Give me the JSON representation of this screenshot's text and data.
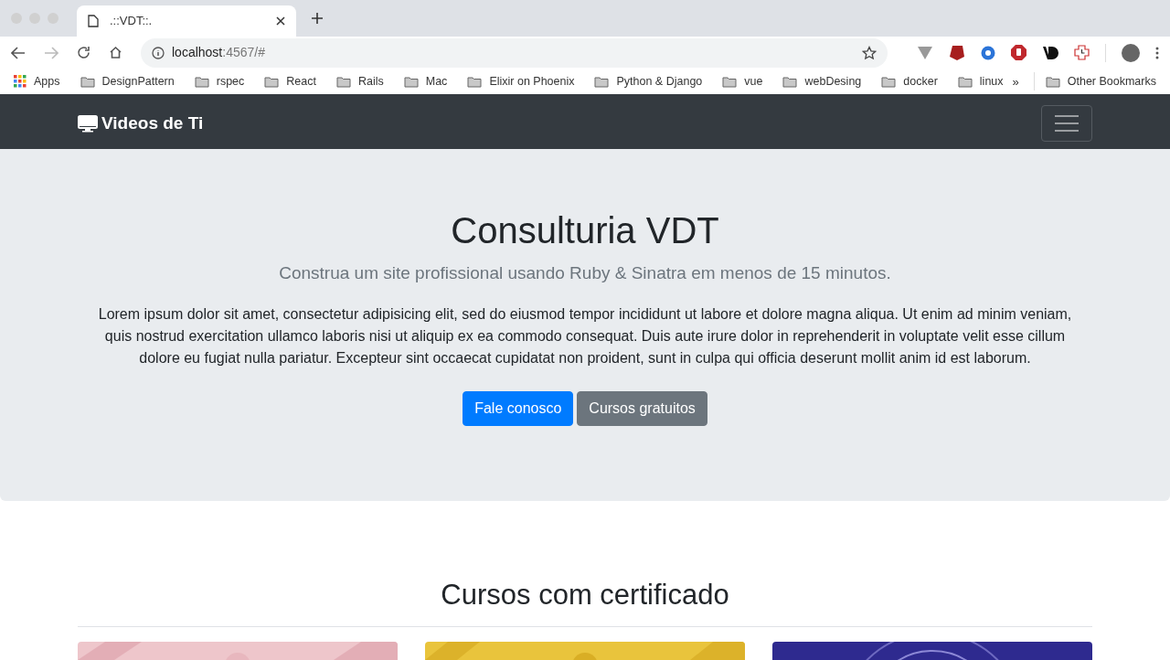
{
  "browser": {
    "tab_title": ".::VDT::.",
    "url_host": "localhost",
    "url_rest": ":4567/#",
    "bookmarks": [
      {
        "label": "Apps",
        "kind": "apps"
      },
      {
        "label": "DesignPattern",
        "kind": "folder"
      },
      {
        "label": "rspec",
        "kind": "folder"
      },
      {
        "label": "React",
        "kind": "folder"
      },
      {
        "label": "Rails",
        "kind": "folder"
      },
      {
        "label": "Mac",
        "kind": "folder"
      },
      {
        "label": "Elixir on Phoenix",
        "kind": "folder"
      },
      {
        "label": "Python & Django",
        "kind": "folder"
      },
      {
        "label": "vue",
        "kind": "folder"
      },
      {
        "label": "webDesing",
        "kind": "folder"
      },
      {
        "label": "docker",
        "kind": "folder"
      },
      {
        "label": "linux",
        "kind": "folder"
      }
    ],
    "overflow": "»",
    "other_bookmarks": "Other Bookmarks"
  },
  "navbar": {
    "brand": "Videos de Ti"
  },
  "hero": {
    "title": "Consulturia VDT",
    "lead": "Construa um site profissional usando Ruby & Sinatra em menos de 15 minutos.",
    "body": "Lorem ipsum dolor sit amet, consectetur adipisicing elit, sed do eiusmod tempor incididunt ut labore et dolore magna aliqua. Ut enim ad minim veniam, quis nostrud exercitation ullamco laboris nisi ut aliquip ex ea commodo consequat. Duis aute irure dolor in reprehenderit in voluptate velit esse cillum dolore eu fugiat nulla pariatur. Excepteur sint occaecat cupidatat non proident, sunt in culpa qui officia deserunt mollit anim id est laborum.",
    "buttons": [
      {
        "label": "Fale conosco",
        "kind": "primary"
      },
      {
        "label": "Cursos gratuitos",
        "kind": "secondary"
      }
    ]
  },
  "courses": {
    "title": "Cursos com certificado"
  }
}
